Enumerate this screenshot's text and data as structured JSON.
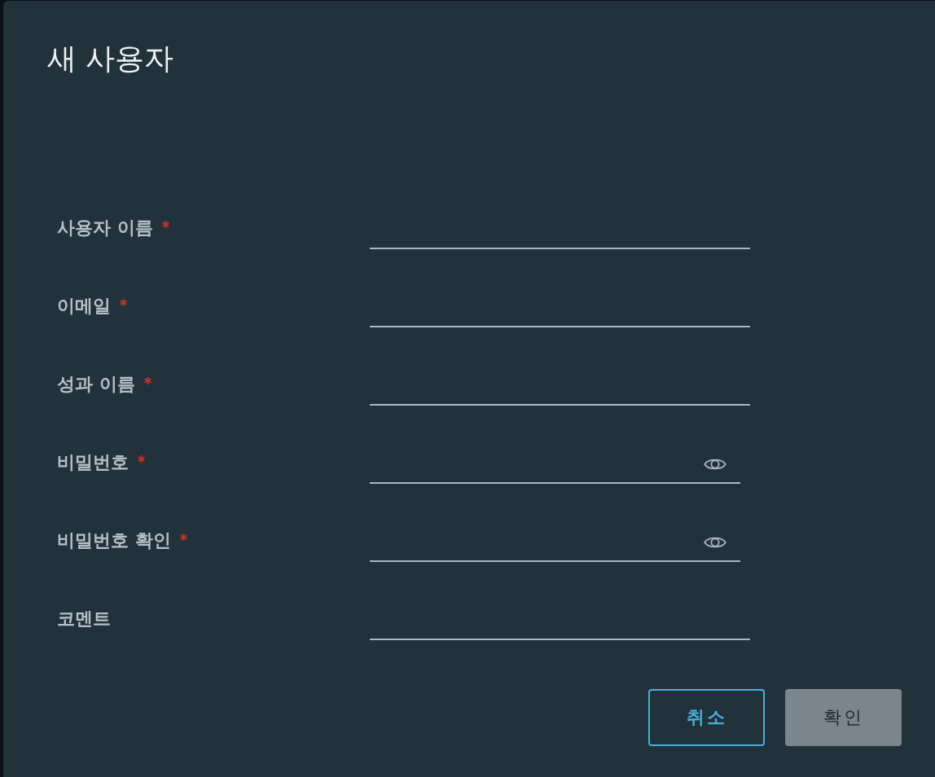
{
  "dialog": {
    "title": "새 사용자"
  },
  "fields": [
    {
      "label": "사용자 이름",
      "required": true,
      "kind": "text"
    },
    {
      "label": "이메일",
      "required": true,
      "kind": "text"
    },
    {
      "label": "성과 이름",
      "required": true,
      "kind": "text"
    },
    {
      "label": "비밀번호",
      "required": true,
      "kind": "password"
    },
    {
      "label": "비밀번호 확인",
      "required": true,
      "kind": "password"
    },
    {
      "label": "코멘트",
      "required": false,
      "kind": "text"
    }
  ],
  "buttons": [
    {
      "label": "취소",
      "kind": "cancel",
      "disabled": false
    },
    {
      "label": "확인",
      "kind": "confirm",
      "disabled": true
    }
  ]
}
